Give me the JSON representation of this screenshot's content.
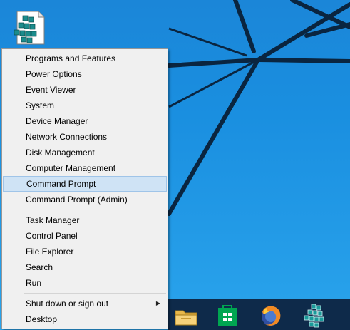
{
  "desktop": {
    "icon_name": "regedit-icon"
  },
  "context_menu": {
    "groups": [
      [
        {
          "label": "Programs and Features",
          "name": "programs-and-features"
        },
        {
          "label": "Power Options",
          "name": "power-options"
        },
        {
          "label": "Event Viewer",
          "name": "event-viewer"
        },
        {
          "label": "System",
          "name": "system"
        },
        {
          "label": "Device Manager",
          "name": "device-manager"
        },
        {
          "label": "Network Connections",
          "name": "network-connections"
        },
        {
          "label": "Disk Management",
          "name": "disk-management"
        },
        {
          "label": "Computer Management",
          "name": "computer-management"
        },
        {
          "label": "Command Prompt",
          "name": "command-prompt",
          "highlighted": true
        },
        {
          "label": "Command Prompt (Admin)",
          "name": "command-prompt-admin"
        }
      ],
      [
        {
          "label": "Task Manager",
          "name": "task-manager"
        },
        {
          "label": "Control Panel",
          "name": "control-panel"
        },
        {
          "label": "File Explorer",
          "name": "file-explorer"
        },
        {
          "label": "Search",
          "name": "search"
        },
        {
          "label": "Run",
          "name": "run"
        }
      ],
      [
        {
          "label": "Shut down or sign out",
          "name": "shut-down-or-sign-out",
          "has_submenu": true
        },
        {
          "label": "Desktop",
          "name": "desktop"
        }
      ]
    ]
  },
  "taskbar": {
    "items": [
      {
        "name": "file-explorer-icon"
      },
      {
        "name": "store-icon"
      },
      {
        "name": "firefox-icon"
      },
      {
        "name": "regedit-icon"
      }
    ]
  },
  "colors": {
    "desktop_blue": "#1a8fe0",
    "taskbar": "#0e2a4a",
    "menu_bg": "#f0f0f0",
    "highlight": "#cfe3f5"
  }
}
